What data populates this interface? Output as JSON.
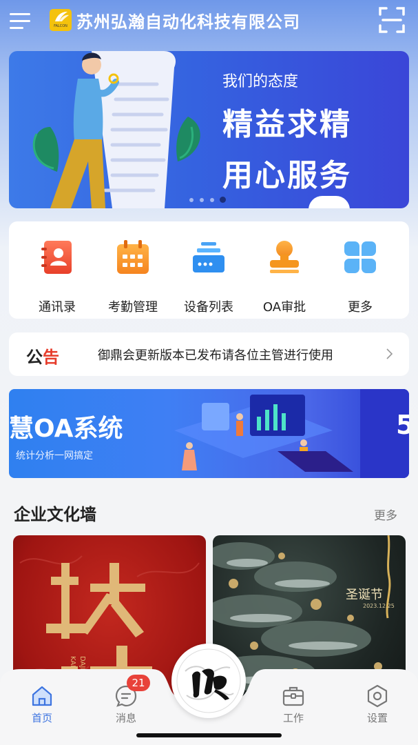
{
  "header": {
    "company_name": "苏州弘瀚自动化科技有限公司",
    "logo_text": "FALCON"
  },
  "banner": {
    "subtitle": "我们的态度",
    "line1": "精益求精",
    "line2": "用心服务",
    "slide_count": 4,
    "active_slide": 4
  },
  "quick_menu": [
    {
      "label": "通讯录",
      "icon": "contacts-icon"
    },
    {
      "label": "考勤管理",
      "icon": "calendar-icon"
    },
    {
      "label": "设备列表",
      "icon": "server-icon"
    },
    {
      "label": "OA审批",
      "icon": "stamp-icon"
    },
    {
      "label": "更多",
      "icon": "grid-icon"
    }
  ],
  "notice": {
    "tag_part1": "公",
    "tag_part2": "告",
    "text": "御鼎会更新版本已发布请各位主管进行使用"
  },
  "oa_banner": {
    "title": "慧OA系统",
    "subtitle": "统计分析一网搞定",
    "side_text": "5"
  },
  "culture": {
    "title": "企业文化墙",
    "more_label": "更多",
    "cards": [
      {
        "title": "",
        "date": ""
      },
      {
        "title": "圣诞节",
        "date": "2023.12.25"
      }
    ]
  },
  "tabbar": {
    "items": [
      {
        "label": "首页",
        "icon": "home-icon",
        "active": true
      },
      {
        "label": "消息",
        "icon": "message-icon",
        "active": false
      },
      {
        "label": "工作",
        "icon": "briefcase-icon",
        "active": false
      },
      {
        "label": "设置",
        "icon": "settings-icon",
        "active": false
      }
    ],
    "message_badge": "21"
  },
  "colors": {
    "accent": "#3d74e0",
    "badge": "#e8423a",
    "notice_highlight": "#e63c2b"
  }
}
